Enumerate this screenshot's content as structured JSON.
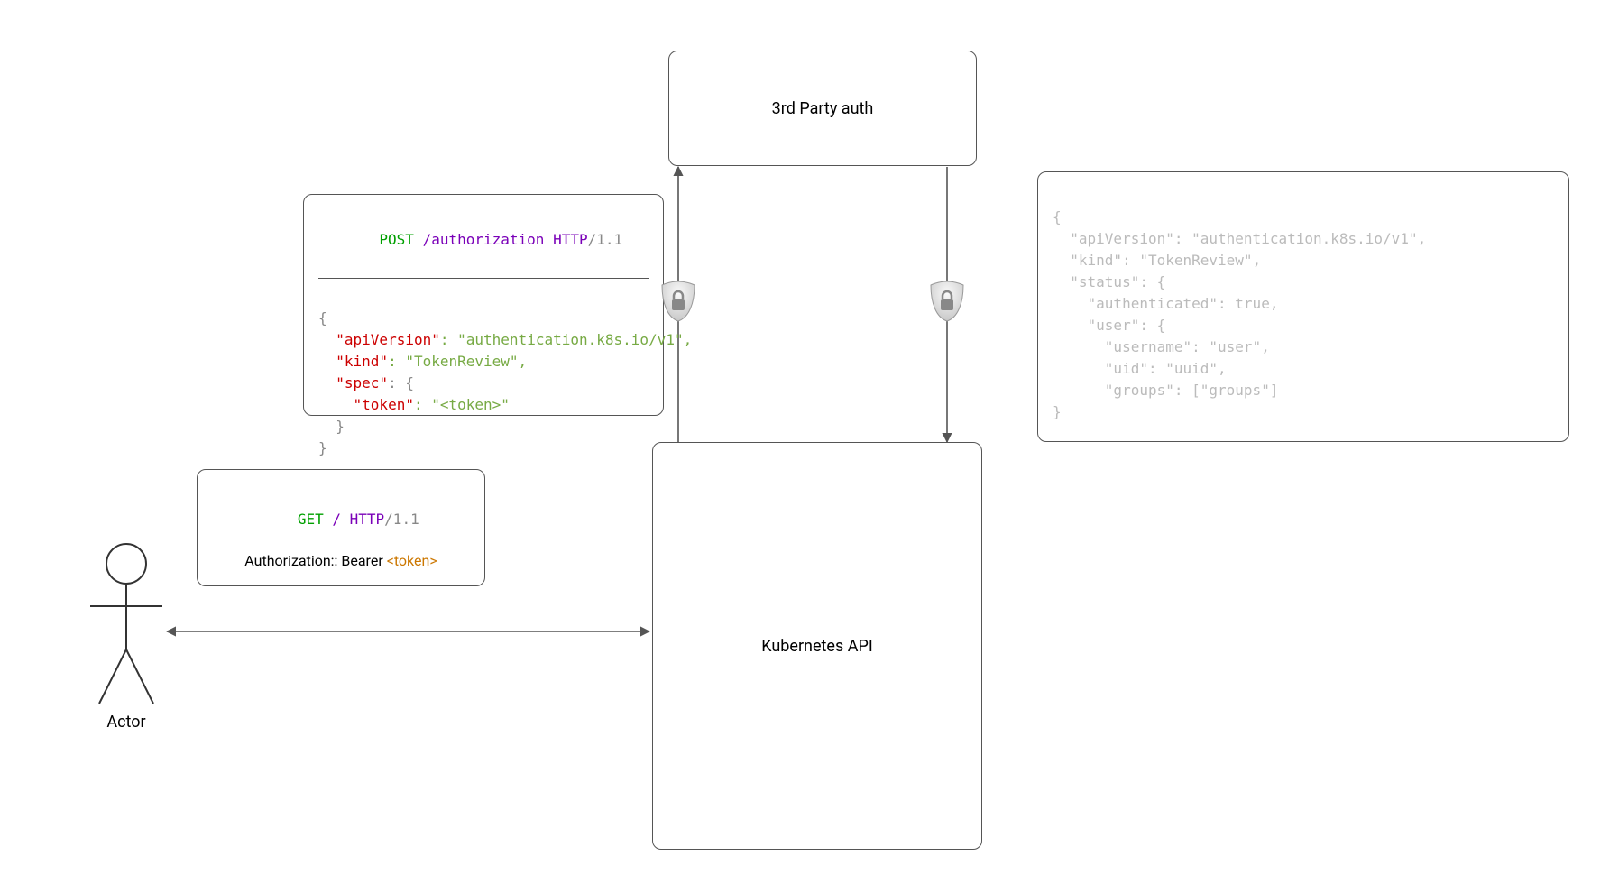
{
  "nodes": {
    "third_party": {
      "label": "3rd Party auth"
    },
    "kubernetes_api": {
      "label": "Kubernetes API"
    },
    "actor": {
      "label": "Actor"
    }
  },
  "request_box": {
    "line1": {
      "method": "POST",
      "path": "/authorization",
      "proto_name": "HTTP",
      "proto_ver": "/1.1"
    },
    "body": {
      "open": "{",
      "k_apiVersion": "\"apiVersion\"",
      "v_apiVersion": ": \"authentication.k8s.io/v1\",",
      "k_kind": "\"kind\"",
      "v_kind": ": \"TokenReview\",",
      "k_spec": "\"spec\"",
      "v_spec_open": ": {",
      "k_token": "\"token\"",
      "v_token": ": \"<token>\"",
      "close_inner": "  }",
      "close_outer": "}"
    }
  },
  "response_box": {
    "l1": "{",
    "l2": "  \"apiVersion\": \"authentication.k8s.io/v1\",",
    "l3": "  \"kind\": \"TokenReview\",",
    "l4": "  \"status\": {",
    "l5": "    \"authenticated\": true,",
    "l6": "    \"user\": {",
    "l7": "      \"username\": \"user\",",
    "l8": "      \"uid\": \"uuid\",",
    "l9": "      \"groups\": [\"groups\"]",
    "l10": "}"
  },
  "get_box": {
    "method": "GET",
    "path": "/",
    "proto_name": "HTTP",
    "proto_ver": "/1.1",
    "auth_label": "Authorization:: Bearer ",
    "auth_token": "<token>"
  }
}
